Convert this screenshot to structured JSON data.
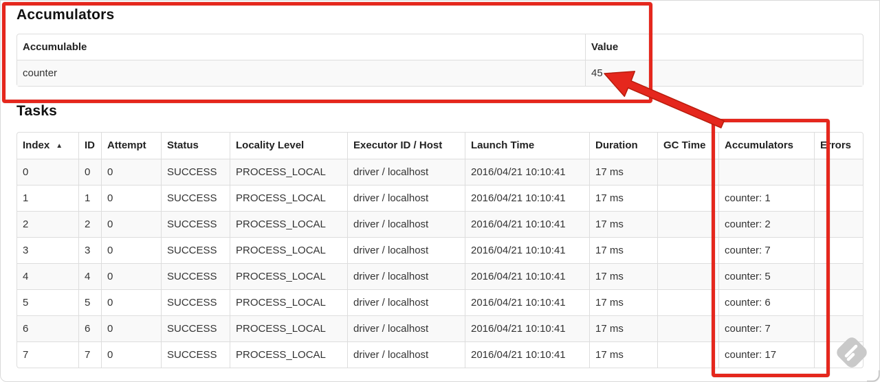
{
  "accumulators_section": {
    "heading": "Accumulators",
    "table": {
      "headers": [
        "Accumulable",
        "Value"
      ],
      "rows": [
        {
          "accumulable": "counter",
          "value": "45"
        }
      ]
    }
  },
  "tasks_section": {
    "heading": "Tasks",
    "sort_indicator": "▲",
    "columns": [
      "Index",
      "ID",
      "Attempt",
      "Status",
      "Locality Level",
      "Executor ID / Host",
      "Launch Time",
      "Duration",
      "GC Time",
      "Accumulators",
      "Errors"
    ],
    "rows": [
      {
        "index": "0",
        "id": "0",
        "attempt": "0",
        "status": "SUCCESS",
        "locality_level": "PROCESS_LOCAL",
        "executor_id_host": "driver / localhost",
        "launch_time": "2016/04/21 10:10:41",
        "duration": "17 ms",
        "gc_time": "",
        "accumulators": "",
        "errors": ""
      },
      {
        "index": "1",
        "id": "1",
        "attempt": "0",
        "status": "SUCCESS",
        "locality_level": "PROCESS_LOCAL",
        "executor_id_host": "driver / localhost",
        "launch_time": "2016/04/21 10:10:41",
        "duration": "17 ms",
        "gc_time": "",
        "accumulators": "counter: 1",
        "errors": ""
      },
      {
        "index": "2",
        "id": "2",
        "attempt": "0",
        "status": "SUCCESS",
        "locality_level": "PROCESS_LOCAL",
        "executor_id_host": "driver / localhost",
        "launch_time": "2016/04/21 10:10:41",
        "duration": "17 ms",
        "gc_time": "",
        "accumulators": "counter: 2",
        "errors": ""
      },
      {
        "index": "3",
        "id": "3",
        "attempt": "0",
        "status": "SUCCESS",
        "locality_level": "PROCESS_LOCAL",
        "executor_id_host": "driver / localhost",
        "launch_time": "2016/04/21 10:10:41",
        "duration": "17 ms",
        "gc_time": "",
        "accumulators": "counter: 7",
        "errors": ""
      },
      {
        "index": "4",
        "id": "4",
        "attempt": "0",
        "status": "SUCCESS",
        "locality_level": "PROCESS_LOCAL",
        "executor_id_host": "driver / localhost",
        "launch_time": "2016/04/21 10:10:41",
        "duration": "17 ms",
        "gc_time": "",
        "accumulators": "counter: 5",
        "errors": ""
      },
      {
        "index": "5",
        "id": "5",
        "attempt": "0",
        "status": "SUCCESS",
        "locality_level": "PROCESS_LOCAL",
        "executor_id_host": "driver / localhost",
        "launch_time": "2016/04/21 10:10:41",
        "duration": "17 ms",
        "gc_time": "",
        "accumulators": "counter: 6",
        "errors": ""
      },
      {
        "index": "6",
        "id": "6",
        "attempt": "0",
        "status": "SUCCESS",
        "locality_level": "PROCESS_LOCAL",
        "executor_id_host": "driver / localhost",
        "launch_time": "2016/04/21 10:10:41",
        "duration": "17 ms",
        "gc_time": "",
        "accumulators": "counter: 7",
        "errors": ""
      },
      {
        "index": "7",
        "id": "7",
        "attempt": "0",
        "status": "SUCCESS",
        "locality_level": "PROCESS_LOCAL",
        "executor_id_host": "driver / localhost",
        "launch_time": "2016/04/21 10:10:41",
        "duration": "17 ms",
        "gc_time": "",
        "accumulators": "counter: 17",
        "errors": ""
      }
    ]
  },
  "annotations": {
    "highlight_color": "#e5271d",
    "boxes": [
      "accumulators-section",
      "tasks-accumulators-column"
    ],
    "arrow_meaning": "per-task accumulator values sum to the total value 45"
  },
  "watermark": {
    "color": "#c9c9c9"
  }
}
